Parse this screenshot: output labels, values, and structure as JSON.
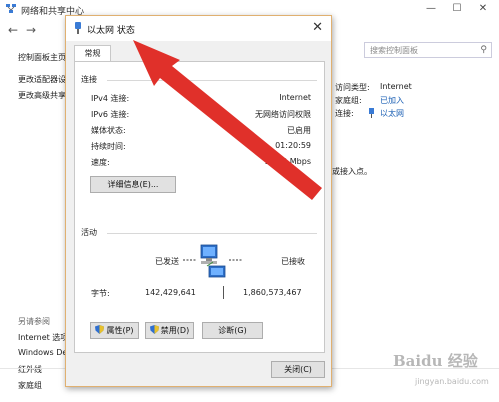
{
  "background": {
    "window_title": "网络和共享中心",
    "search_placeholder": "搜索控制面板",
    "sidebar": {
      "home": "控制面板主页",
      "links": [
        "更改适配器设",
        "更改高级共享"
      ],
      "see_also_title": "另请参阅",
      "see_also": [
        "Internet 选项",
        "Windows De",
        "红外线",
        "家庭组"
      ]
    },
    "right_panel": {
      "access_type_label": "访问类型:",
      "access_type_value": "Internet",
      "homegroup_label": "家庭组:",
      "homegroup_value": "已加入",
      "connection_label": "连接:",
      "connection_value": "以太网",
      "partial_text": "或接入点。"
    }
  },
  "dialog": {
    "title": "以太网 状态",
    "tab": "常规",
    "connection_section": {
      "label": "连接",
      "rows": [
        {
          "label": "IPv4 连接:",
          "value": "Internet"
        },
        {
          "label": "IPv6 连接:",
          "value": "无网络访问权限"
        },
        {
          "label": "媒体状态:",
          "value": "已启用"
        },
        {
          "label": "持续时间:",
          "value": "01:20:59"
        },
        {
          "label": "速度:",
          "value": "100.0 Mbps"
        }
      ],
      "details_button": "详细信息(E)..."
    },
    "activity_section": {
      "label": "活动",
      "sent_label": "已发送",
      "received_label": "已接收",
      "bytes_label": "字节:",
      "bytes_sent": "142,429,641",
      "bytes_received": "1,860,573,467"
    },
    "buttons": {
      "properties": "属性(P)",
      "disable": "禁用(D)",
      "diagnose": "诊断(G)",
      "close": "关闭(C)"
    }
  },
  "watermark": {
    "brand": "Baidu 经验",
    "url": "jingyan.baidu.com"
  },
  "colors": {
    "dialog_border": "#e0b070",
    "link": "#1a5fb4",
    "arrow": "#e0302a"
  }
}
